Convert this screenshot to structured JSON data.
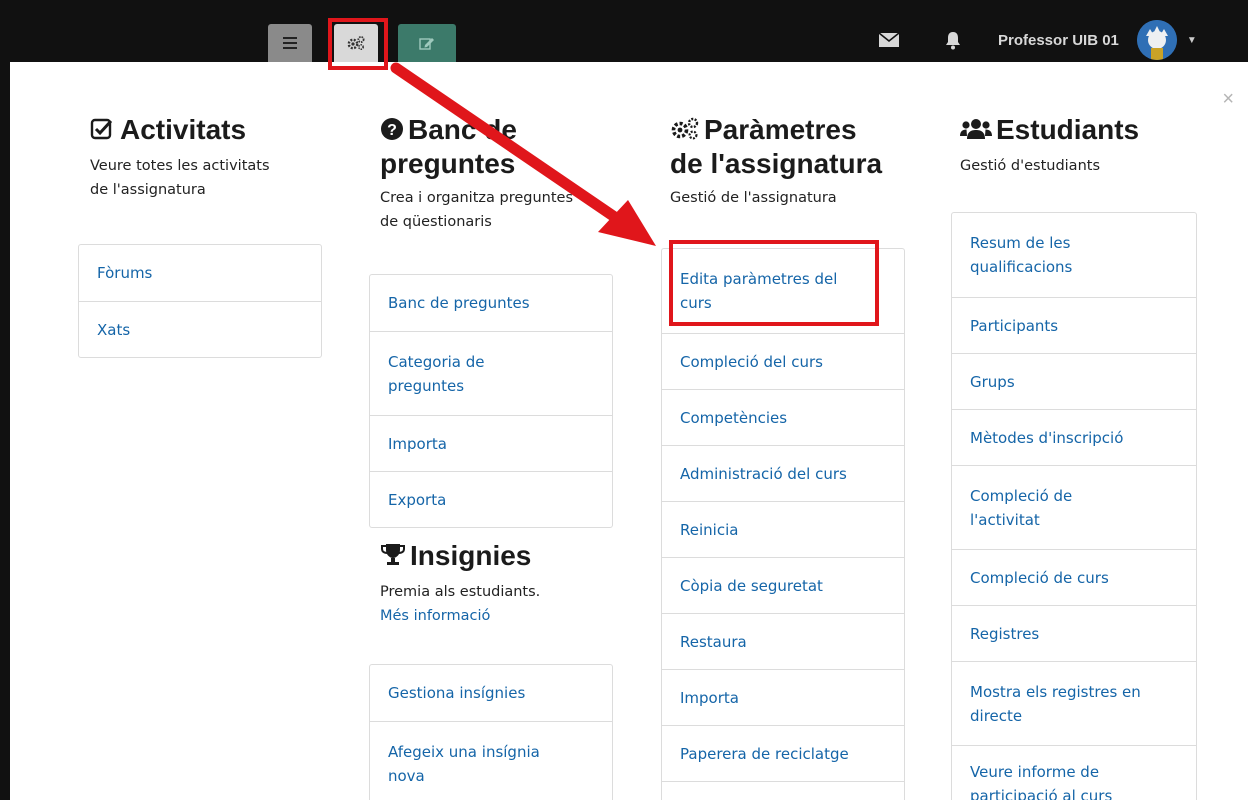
{
  "topbar": {
    "user_name": "Professor UIB 01"
  },
  "columns": {
    "activitats": {
      "title": "Activitats",
      "desc_line1": "Veure totes les activitats",
      "desc_line2": "de l'assignatura",
      "items": [
        "Fòrums",
        "Xats"
      ]
    },
    "banc": {
      "title_line1": "Banc de",
      "title_line2": "preguntes",
      "desc_line1": "Crea i organitza preguntes",
      "desc_line2": "de qüestionaris",
      "items": [
        {
          "l1": "Banc de preguntes",
          "l2": ""
        },
        {
          "l1": "Categoria de",
          "l2": "preguntes"
        },
        {
          "l1": "Importa",
          "l2": ""
        },
        {
          "l1": "Exporta",
          "l2": ""
        }
      ]
    },
    "insignies": {
      "title": "Insignies",
      "desc": "Premia als estudiants.",
      "more": "Més informació",
      "items": [
        {
          "l1": "Gestiona insígnies",
          "l2": ""
        },
        {
          "l1": "Afegeix una insígnia",
          "l2": "nova"
        }
      ]
    },
    "parametres": {
      "title_line1": "Paràmetres",
      "title_line2": "de l'assignatura",
      "desc": "Gestió de l'assignatura",
      "items": [
        {
          "l1": "Edita paràmetres del",
          "l2": "curs"
        },
        {
          "l1": "Compleció del curs",
          "l2": ""
        },
        {
          "l1": "Competències",
          "l2": ""
        },
        {
          "l1": "Administració del curs",
          "l2": ""
        },
        {
          "l1": "Reinicia",
          "l2": ""
        },
        {
          "l1": "Còpia de seguretat",
          "l2": ""
        },
        {
          "l1": "Restaura",
          "l2": ""
        },
        {
          "l1": "Importa",
          "l2": ""
        },
        {
          "l1": "Paperera de reciclatge",
          "l2": ""
        }
      ]
    },
    "estudiants": {
      "title": "Estudiants",
      "desc": "Gestió d'estudiants",
      "items": [
        {
          "l1": "Resum de les",
          "l2": "qualificacions"
        },
        {
          "l1": "Participants",
          "l2": ""
        },
        {
          "l1": "Grups",
          "l2": ""
        },
        {
          "l1": "Mètodes d'inscripció",
          "l2": ""
        },
        {
          "l1": "Compleció de",
          "l2": "l'activitat"
        },
        {
          "l1": "Compleció de curs",
          "l2": ""
        },
        {
          "l1": "Registres",
          "l2": ""
        },
        {
          "l1": "Mostra els registres en",
          "l2": "directe"
        },
        {
          "l1": "Veure informe de",
          "l2": "participació al curs"
        }
      ]
    }
  },
  "colors": {
    "link": "#1565a8",
    "highlight": "#e0161b",
    "topbar": "#111111"
  },
  "icons": {
    "activitats": "checked-square-icon",
    "banc": "question-circle-icon",
    "parametres": "cogs-icon",
    "estudiants": "users-icon",
    "insignies": "trophy-icon"
  }
}
